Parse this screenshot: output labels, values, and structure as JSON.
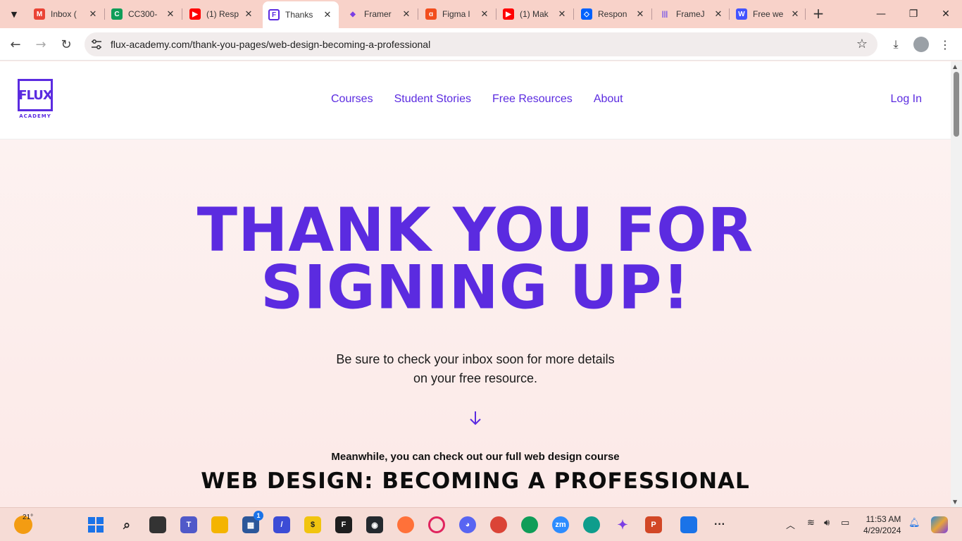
{
  "browser": {
    "tabs": [
      {
        "label": "Inbox (",
        "favicon": "gmail-icon",
        "active": false
      },
      {
        "label": "CC300-",
        "favicon": "classroom-icon",
        "active": false
      },
      {
        "label": "(1) Resp",
        "favicon": "youtube-icon",
        "active": false
      },
      {
        "label": "Thanks",
        "favicon": "flux-icon",
        "active": true
      },
      {
        "label": "Framer",
        "favicon": "framer-icon",
        "active": false
      },
      {
        "label": "Figma l",
        "favicon": "figma-icon",
        "active": false
      },
      {
        "label": "(1) Mak",
        "favicon": "youtube-icon",
        "active": false
      },
      {
        "label": "Respon",
        "favicon": "dropbox-icon",
        "active": false
      },
      {
        "label": "FrameJ",
        "favicon": "framejs-icon",
        "active": false
      },
      {
        "label": "Free we",
        "favicon": "webflow-icon",
        "active": false
      }
    ],
    "url": "flux-academy.com/thank-you-pages/web-design-becoming-a-professional"
  },
  "site": {
    "logo_text": "FLUX",
    "logo_sub": "ACADEMY",
    "nav": [
      "Courses",
      "Student Stories",
      "Free Resources",
      "About"
    ],
    "login": "Log In",
    "hero_line1": "THANK YOU FOR",
    "hero_line2": "SIGNING UP!",
    "hero_sub": "Be sure to check your inbox soon for more details on your free resource.",
    "meanwhile": "Meanwhile, you can check out our full web design course",
    "course_title": "WEB DESIGN: BECOMING A PROFESSIONAL",
    "accent_color": "#5b2be0"
  },
  "taskbar": {
    "weather_temp": "21°",
    "store_badge": "1",
    "time": "11:53 AM",
    "date": "4/29/2024"
  }
}
